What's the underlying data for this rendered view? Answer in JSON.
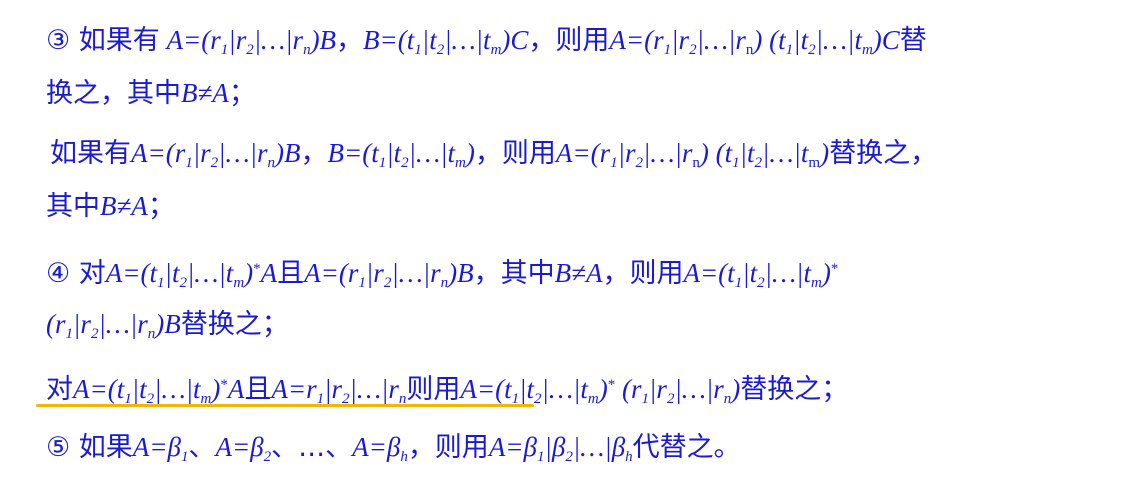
{
  "colors": {
    "text": "#1a1ad6",
    "underline": "#f5b400",
    "background": "#ffffff"
  },
  "rule3": {
    "l1a": "③ 如果有",
    "l1b": "A=(r1|r2|…|rn)B，B=(t1|t2|…|tm)C，则用A=(r1|r2|…|rn) (t1|t2|…|tm)C替",
    "l2": "换之，其中B≠A；"
  },
  "rule3b": {
    "l1": "如果有A=(r1|r2|…|rn)B，B=(t1|t2|…|tm)，则用A=(r1|r2|…|rn) (t1|t2|…|tm)替换之，",
    "l2": "其中B≠A；"
  },
  "rule4": {
    "l1": "④ 对A=(t1|t2|…|tm)*A且A=(r1|r2|…|rn)B，其中B≠A，则用A=(t1|t2|…|tm)*",
    "l2": "(r1|r2|…|rn)B替换之；"
  },
  "rule4b": {
    "l1": "对A=(t1|t2|…|tm)*A且A=r1|r2|…|rn则用A=(t1|t2|…|tm)* (r1|r2|…|rn)替换之；"
  },
  "rule5": {
    "l1": "⑤ 如果A=β1、A=β2、…、A=βh，则用A=β1|β2|…|βh代替之。"
  }
}
